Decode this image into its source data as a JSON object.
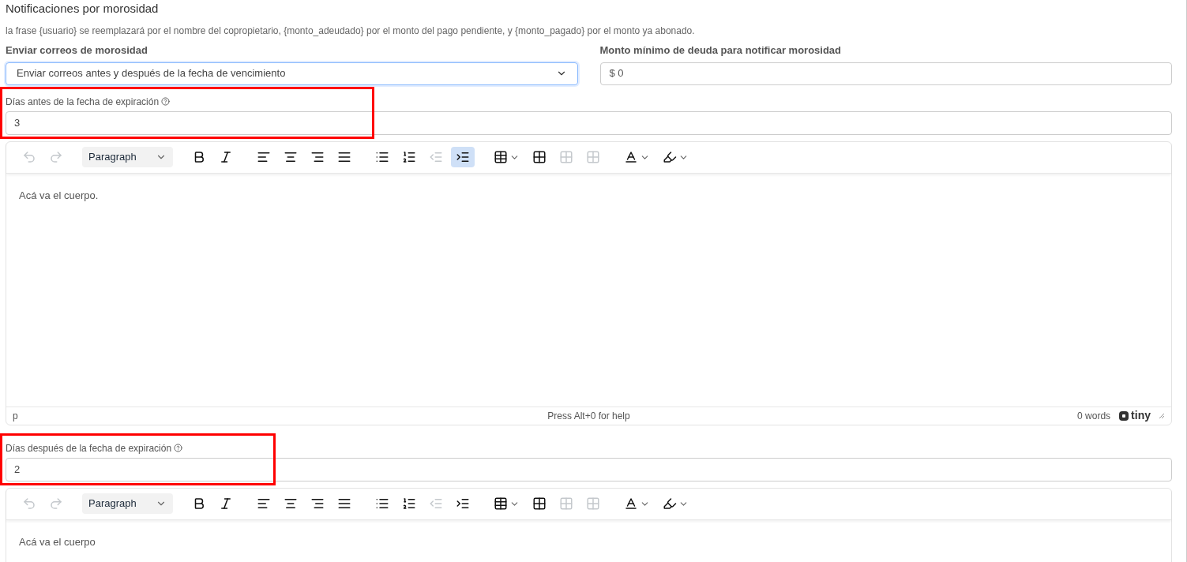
{
  "section": {
    "title": "Notificaciones por morosidad",
    "description": "la frase {usuario} se reemplazará por el nombre del copropietario, {monto_adeudado} por el monto del pago pendiente, y {monto_pagado} por el monto ya abonado."
  },
  "send_mode": {
    "label": "Enviar correos de morosidad",
    "value": "Enviar correos antes y después de la fecha de vencimiento",
    "focused": true
  },
  "min_debt": {
    "label": "Monto mínimo de deuda para notificar morosidad",
    "value": "$ 0"
  },
  "blocks": [
    {
      "label": "Días antes de la fecha de expiración",
      "value": "3",
      "highlighted": true,
      "editor": {
        "block_format": "Paragraph",
        "body": "Acá va el cuerpo.",
        "status_bar": {
          "path": "p",
          "help": "Press Alt+0 for help",
          "word_count": "0 words",
          "brand": "tiny"
        },
        "tools": [
          {
            "disabled": true,
            "selected": false
          },
          {
            "disabled": true,
            "selected": false
          },
          {
            "disabled": false,
            "selected": false
          },
          {
            "disabled": false,
            "selected": false
          },
          {
            "disabled": false,
            "selected": false
          },
          {
            "disabled": false,
            "selected": false
          },
          {
            "disabled": false,
            "selected": false
          },
          {
            "disabled": false,
            "selected": false
          },
          {
            "disabled": false,
            "selected": false
          },
          {
            "disabled": false,
            "selected": false
          },
          {
            "disabled": true,
            "selected": false
          },
          {
            "disabled": false,
            "selected": true
          },
          {
            "disabled": false,
            "selected": false
          },
          {
            "disabled": false,
            "selected": false
          },
          {
            "disabled": true,
            "selected": false
          },
          {
            "disabled": true,
            "selected": false
          },
          {
            "disabled": false,
            "selected": false
          },
          {
            "disabled": false,
            "selected": false
          }
        ]
      }
    },
    {
      "label": "Días después de la fecha de expiración",
      "value": "2",
      "highlighted": true,
      "editor": {
        "block_format": "Paragraph",
        "body": "Acá va el cuerpo",
        "tools": [
          {
            "disabled": true,
            "selected": false
          },
          {
            "disabled": true,
            "selected": false
          },
          {
            "disabled": false,
            "selected": false
          },
          {
            "disabled": false,
            "selected": false
          },
          {
            "disabled": false,
            "selected": false
          },
          {
            "disabled": false,
            "selected": false
          },
          {
            "disabled": false,
            "selected": false
          },
          {
            "disabled": false,
            "selected": false
          },
          {
            "disabled": false,
            "selected": false
          },
          {
            "disabled": false,
            "selected": false
          },
          {
            "disabled": true,
            "selected": false
          },
          {
            "disabled": false,
            "selected": false
          },
          {
            "disabled": false,
            "selected": false
          },
          {
            "disabled": false,
            "selected": false
          },
          {
            "disabled": true,
            "selected": false
          },
          {
            "disabled": true,
            "selected": false
          },
          {
            "disabled": false,
            "selected": false
          },
          {
            "disabled": false,
            "selected": false
          }
        ]
      }
    }
  ]
}
